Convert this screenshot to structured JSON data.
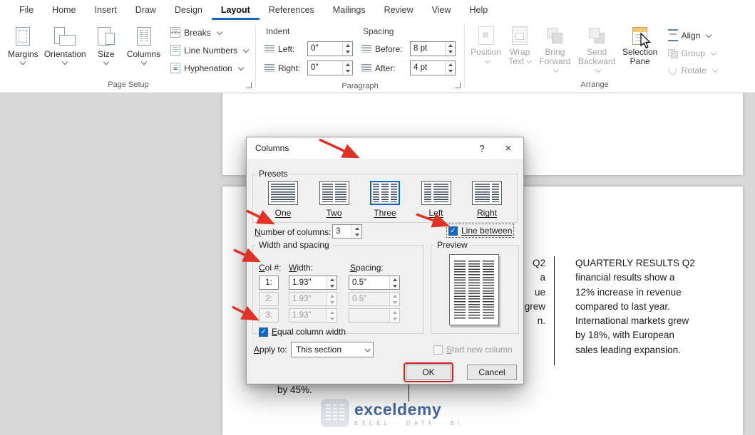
{
  "colors": {
    "accent_blue": "#1668c6",
    "checkbox_blue": "#1566c0",
    "annotation_red": "#df3226",
    "watermark_blue": "#47679f",
    "canvas_gray": "#d8d8d8"
  },
  "icons": {
    "check": "✓",
    "help": "?",
    "close": "×"
  },
  "ribbon": {
    "tabs": [
      {
        "label": "File"
      },
      {
        "label": "Home"
      },
      {
        "label": "Insert"
      },
      {
        "label": "Draw"
      },
      {
        "label": "Design"
      },
      {
        "label": "Layout",
        "active": true
      },
      {
        "label": "References"
      },
      {
        "label": "Mailings"
      },
      {
        "label": "Review"
      },
      {
        "label": "View"
      },
      {
        "label": "Help"
      }
    ],
    "page_setup": {
      "label": "Page Setup",
      "margins": "Margins",
      "orientation": "Orientation",
      "size": "Size",
      "columns": "Columns",
      "breaks": "Breaks",
      "line_numbers": "Line Numbers",
      "hyphenation": "Hyphenation"
    },
    "paragraph": {
      "label": "Paragraph",
      "indent": "Indent",
      "spacing": "Spacing",
      "left": "Left:",
      "right": "Right:",
      "before": "Before:",
      "after": "After:",
      "left_value": "0\"",
      "right_value": "0\"",
      "before_value": "8 pt",
      "after_value": "4 pt"
    },
    "arrange": {
      "label": "Arrange",
      "position": "Position",
      "wrap_text": "Wrap Text",
      "bring_forward": "Bring Forward",
      "send_backward": "Send Backward",
      "selection_pane": "Selection Pane",
      "align": "Align",
      "group": "Group",
      "rotate": "Rotate"
    }
  },
  "dialog": {
    "title": "Columns",
    "presets_label": "Presets",
    "presets": [
      {
        "label": "One",
        "selected": false
      },
      {
        "label": "Two",
        "selected": false
      },
      {
        "label": "Three",
        "selected": true
      },
      {
        "label": "Left",
        "selected": false
      },
      {
        "label": "Right",
        "selected": false
      }
    ],
    "number_of_columns_label": "Number of columns:",
    "number_of_columns_value": "3",
    "line_between_label": "Line between",
    "line_between_checked": true,
    "width_spacing": {
      "label": "Width and spacing",
      "col_header": "Col #:",
      "width_header": "Width:",
      "spacing_header": "Spacing:",
      "rows": [
        {
          "col": "1:",
          "width": "1.93\"",
          "spacing": "0.5\"",
          "enabled": true
        },
        {
          "col": "2:",
          "width": "1.93\"",
          "spacing": "0.5\"",
          "enabled": false
        },
        {
          "col": "3:",
          "width": "1.93\"",
          "spacing": "",
          "enabled": false
        }
      ],
      "equal_width_label": "Equal column width",
      "equal_width_checked": true
    },
    "preview_label": "Preview",
    "apply_to_label": "Apply to:",
    "apply_to_value": "This section",
    "start_new_column_label": "Start new column",
    "start_new_column_checked": false,
    "ok_label": "OK",
    "cancel_label": "Cancel"
  },
  "document": {
    "right_column": [
      "QUARTERLY RESULTS Q2",
      "financial results show a",
      "12% increase in revenue",
      "compared to last year.",
      "International markets grew",
      "by 18%, with European",
      "sales leading expansion."
    ],
    "middle_fragments": [
      "Q2",
      "a",
      "ue",
      "",
      "grew",
      "",
      "n."
    ],
    "left_fragment": "by 45%.",
    "watermark_brand": "exceldemy",
    "watermark_sub": "EXCEL · DATA · BI"
  }
}
